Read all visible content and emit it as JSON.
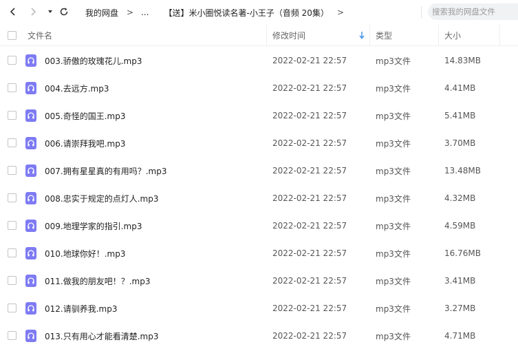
{
  "toolbar": {
    "back_icon": "chevron-left-icon",
    "forward_icon": "chevron-right-icon",
    "history_icon": "caret-down-icon",
    "refresh_icon": "refresh-icon",
    "breadcrumb": {
      "root": "我的网盘",
      "ellipsis": "...",
      "current": "【送】米小圈悦读名著-小王子（音频 20集）",
      "separator": ">"
    },
    "search_placeholder": "搜索我的网盘文件"
  },
  "table": {
    "headers": {
      "name": "文件名",
      "modified": "修改时间",
      "type": "类型",
      "size": "大小"
    },
    "sort": {
      "column": "modified",
      "direction": "descending",
      "indicator_color": "#3b8eea"
    },
    "rows": [
      {
        "name": "003.骄傲的玫瑰花儿.mp3",
        "modified": "2022-02-21 22:57",
        "type": "mp3文件",
        "size": "14.83MB"
      },
      {
        "name": "004.去远方.mp3",
        "modified": "2022-02-21 22:57",
        "type": "mp3文件",
        "size": "4.41MB"
      },
      {
        "name": "005.奇怪的国王.mp3",
        "modified": "2022-02-21 22:57",
        "type": "mp3文件",
        "size": "5.41MB"
      },
      {
        "name": "006.请崇拜我吧.mp3",
        "modified": "2022-02-21 22:57",
        "type": "mp3文件",
        "size": "3.70MB"
      },
      {
        "name": "007.拥有星星真的有用吗？.mp3",
        "modified": "2022-02-21 22:57",
        "type": "mp3文件",
        "size": "13.48MB"
      },
      {
        "name": "008.忠实于规定的点灯人.mp3",
        "modified": "2022-02-21 22:57",
        "type": "mp3文件",
        "size": "4.32MB"
      },
      {
        "name": "009.地理学家的指引.mp3",
        "modified": "2022-02-21 22:57",
        "type": "mp3文件",
        "size": "4.59MB"
      },
      {
        "name": "010.地球你好！.mp3",
        "modified": "2022-02-21 22:57",
        "type": "mp3文件",
        "size": "16.76MB"
      },
      {
        "name": "011.做我的朋友吧！？.mp3",
        "modified": "2022-02-21 22:57",
        "type": "mp3文件",
        "size": "3.41MB"
      },
      {
        "name": "012.请驯养我.mp3",
        "modified": "2022-02-21 22:57",
        "type": "mp3文件",
        "size": "3.27MB"
      },
      {
        "name": "013.只有用心才能看清楚.mp3",
        "modified": "2022-02-21 22:57",
        "type": "mp3文件",
        "size": "4.71MB"
      }
    ],
    "row_icon": "audio-file-icon",
    "row_icon_color": "#7e7bf4"
  }
}
